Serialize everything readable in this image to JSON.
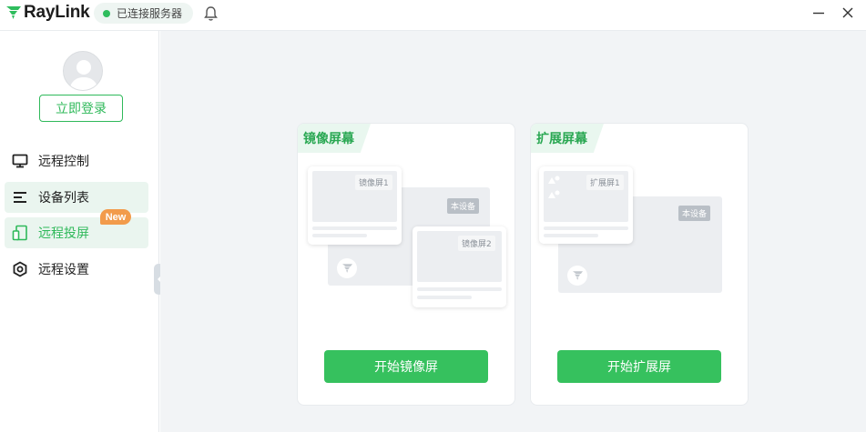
{
  "app": {
    "name": "RayLink"
  },
  "status": {
    "text": "已连接服务器",
    "color": "#2fbd5d"
  },
  "sidebar": {
    "login_label": "立即登录",
    "items": [
      {
        "label": "远程控制",
        "icon": "monitor-icon"
      },
      {
        "label": "设备列表",
        "icon": "list-icon"
      },
      {
        "label": "远程投屏",
        "icon": "cast-screen-icon",
        "badge": "New",
        "active": true
      },
      {
        "label": "远程设置",
        "icon": "settings-hex-icon"
      }
    ]
  },
  "cards": [
    {
      "tag": "镜像屏幕",
      "button": "开始镜像屏",
      "labels": {
        "window1": "镜像屏1",
        "device": "本设备",
        "window2": "镜像屏2"
      }
    },
    {
      "tag": "扩展屏幕",
      "button": "开始扩展屏",
      "labels": {
        "window1": "扩展屏1",
        "device": "本设备"
      }
    }
  ],
  "colors": {
    "accent": "#36c15e",
    "badge": "#f29b4b",
    "active_bg": "#eaf5ef"
  }
}
